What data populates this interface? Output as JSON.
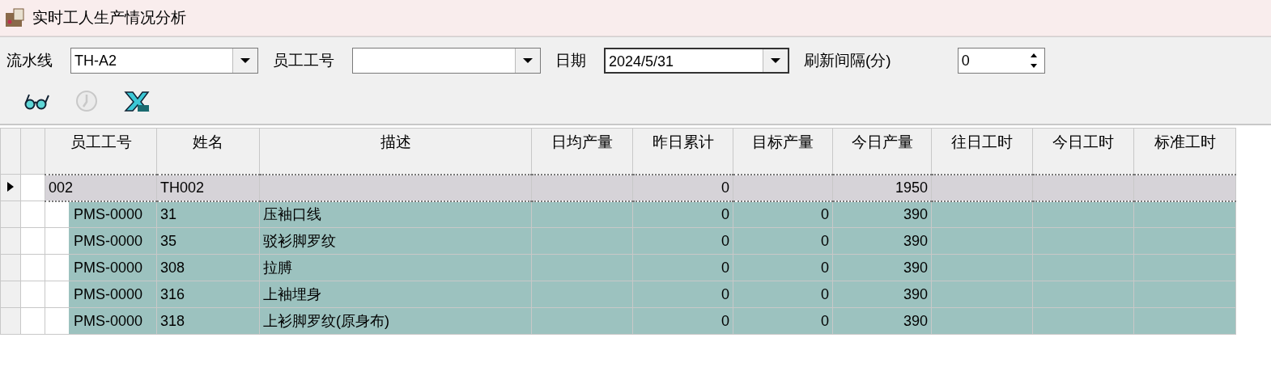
{
  "window": {
    "title": "实时工人生产情况分析"
  },
  "filters": [
    {
      "kind": "combo",
      "label": "流水线",
      "value": "TH-A2"
    },
    {
      "kind": "combo",
      "label": "员工工号"
    },
    {
      "kind": "combo",
      "label": "日期",
      "value": "2024/5/31",
      "focused": true
    },
    {
      "kind": "spin",
      "label": "刷新间隔(分)",
      "value": "0"
    }
  ],
  "toolbar": [
    {
      "kind": "glasses",
      "disabled": false
    },
    {
      "kind": "clock",
      "disabled": true
    },
    {
      "kind": "export",
      "disabled": false
    }
  ],
  "table": {
    "columns": [
      "员工工号",
      "姓名",
      "描述",
      "日均产量",
      "昨日累计",
      "目标产量",
      "今日产量",
      "往日工时",
      "今日工时",
      "标准工时"
    ],
    "rows": [
      {
        "kind": "group",
        "selected": true,
        "cells": [
          "002",
          "TH002",
          null,
          null,
          "0",
          null,
          "1950",
          null,
          null,
          null
        ]
      },
      {
        "kind": "detail",
        "selected": false,
        "cells": [
          "PMS-0000",
          "31",
          "压袖口线",
          null,
          "0",
          "0",
          "390",
          null,
          null,
          null
        ]
      },
      {
        "kind": "detail",
        "selected": false,
        "cells": [
          "PMS-0000",
          "35",
          "驳衫脚罗纹",
          null,
          "0",
          "0",
          "390",
          null,
          null,
          null
        ]
      },
      {
        "kind": "detail",
        "selected": false,
        "cells": [
          "PMS-0000",
          "308",
          "拉膊",
          null,
          "0",
          "0",
          "390",
          null,
          null,
          null
        ]
      },
      {
        "kind": "detail",
        "selected": false,
        "cells": [
          "PMS-0000",
          "316",
          "上袖埋身",
          null,
          "0",
          "0",
          "390",
          null,
          null,
          null
        ]
      },
      {
        "kind": "detail",
        "selected": false,
        "cells": [
          "PMS-0000",
          "318",
          "上衫脚罗纹(原身布)",
          null,
          "0",
          "0",
          "390",
          null,
          null,
          null
        ]
      }
    ]
  }
}
